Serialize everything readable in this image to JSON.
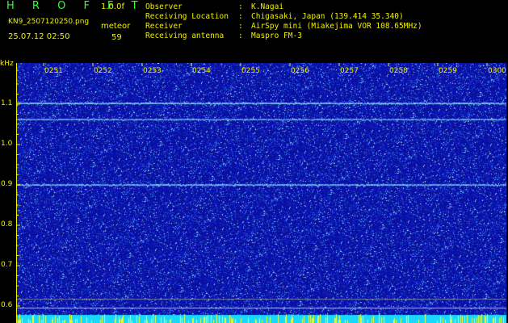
{
  "header": {
    "logo": "H R O F F T",
    "version": "1.0.0f",
    "filename": "KN9_2507120250.png",
    "datetime": "25.07.12 02:50",
    "meteor_label": "meteor",
    "meteor_count": "59"
  },
  "info": [
    {
      "label": "Observer",
      "sep": ":",
      "value": "K.Nagai"
    },
    {
      "label": "Receiving Location",
      "sep": ":",
      "value": "Chigasaki, Japan (139.414 35.340)"
    },
    {
      "label": "Receiver",
      "sep": ":",
      "value": "AirSpy mini (Miakejima VOR 108.65MHz)"
    },
    {
      "label": "Receiving antenna",
      "sep": ":",
      "value": "Maspro FM-3"
    }
  ],
  "axis": {
    "y_unit": "kHz",
    "y_ticks": [
      {
        "label": "1.1",
        "value": 1.1
      },
      {
        "label": "1.0",
        "value": 1.0
      },
      {
        "label": "0.9",
        "value": 0.9
      },
      {
        "label": "0.8",
        "value": 0.8
      },
      {
        "label": "0.7",
        "value": 0.7
      },
      {
        "label": "0.6",
        "value": 0.6
      }
    ],
    "x_ticks": [
      "0251",
      "0252",
      "0253",
      "0254",
      "0255",
      "0256",
      "0257",
      "0258",
      "0259",
      "0300"
    ]
  },
  "colors": {
    "text": "#f0f000",
    "logo": "#32ff32",
    "spectrogram_bg": "#0a10a0",
    "carrier_line": "#7ad8ff",
    "bottom_band": "#18d8ff"
  }
}
